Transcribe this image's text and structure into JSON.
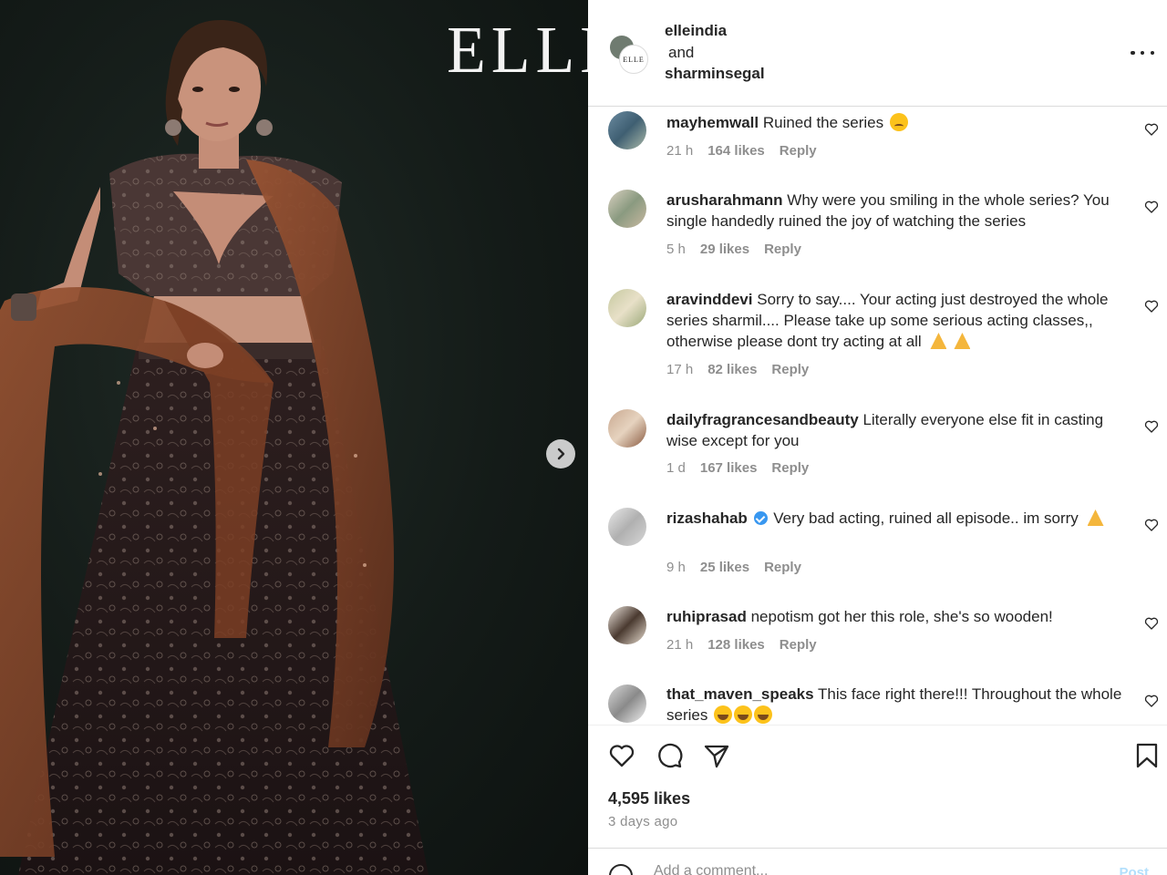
{
  "post": {
    "magazine_logo": "ELLE",
    "header": {
      "users": [
        "elleindia",
        "and",
        "sharminsegal"
      ],
      "avatar_badge": "ELLE"
    },
    "comments": [
      {
        "username": "mayhemwall",
        "text": "Ruined the series",
        "emoji": "crying-face",
        "time": "21 h",
        "likes": "164 likes",
        "reply": "Reply",
        "verified": false
      },
      {
        "username": "arusharahmann",
        "text": "Why were you smiling in the whole series? You single handedly ruined the joy of watching the series",
        "time": "5 h",
        "likes": "29 likes",
        "reply": "Reply",
        "verified": false
      },
      {
        "username": "aravinddevi",
        "text": "Sorry to say.... Your acting just destroyed the whole series sharmil.... Please take up some serious acting classes,, otherwise please dont try acting at all",
        "emoji": "folded-hands x2",
        "time": "17 h",
        "likes": "82 likes",
        "reply": "Reply",
        "verified": false
      },
      {
        "username": "dailyfragrancesandbeauty",
        "text": "Literally everyone else fit in casting wise except for you",
        "time": "1 d",
        "likes": "167 likes",
        "reply": "Reply",
        "verified": false
      },
      {
        "username": "rizashahab",
        "text": "Very bad acting, ruined all episode.. im sorry",
        "emoji": "folded-hands",
        "time": "9 h",
        "likes": "25 likes",
        "reply": "Reply",
        "verified": true
      },
      {
        "username": "ruhiprasad",
        "text": "nepotism got her this role, she's so wooden!",
        "time": "21 h",
        "likes": "128 likes",
        "reply": "Reply",
        "verified": false
      },
      {
        "username": "that_maven_speaks",
        "text": "This face right there!!! Throughout the whole series",
        "emoji": "laughing-crying x3",
        "verified": false
      }
    ],
    "likes_total": "4,595 likes",
    "posted_ago": "3 days ago",
    "add_comment_placeholder": "Add a comment...",
    "post_label": "Post",
    "icons": [
      "more-icon",
      "heart-icon",
      "comment-icon",
      "share-icon",
      "bookmark-icon",
      "smile-icon",
      "chevron-right-icon"
    ],
    "colors": {
      "text": "#262626",
      "muted": "#8e8e8e",
      "verified": "#3897f0",
      "divider": "#dbdbdb",
      "photo_bg": "#141b18",
      "dupatta": "#8a4a2c"
    }
  }
}
